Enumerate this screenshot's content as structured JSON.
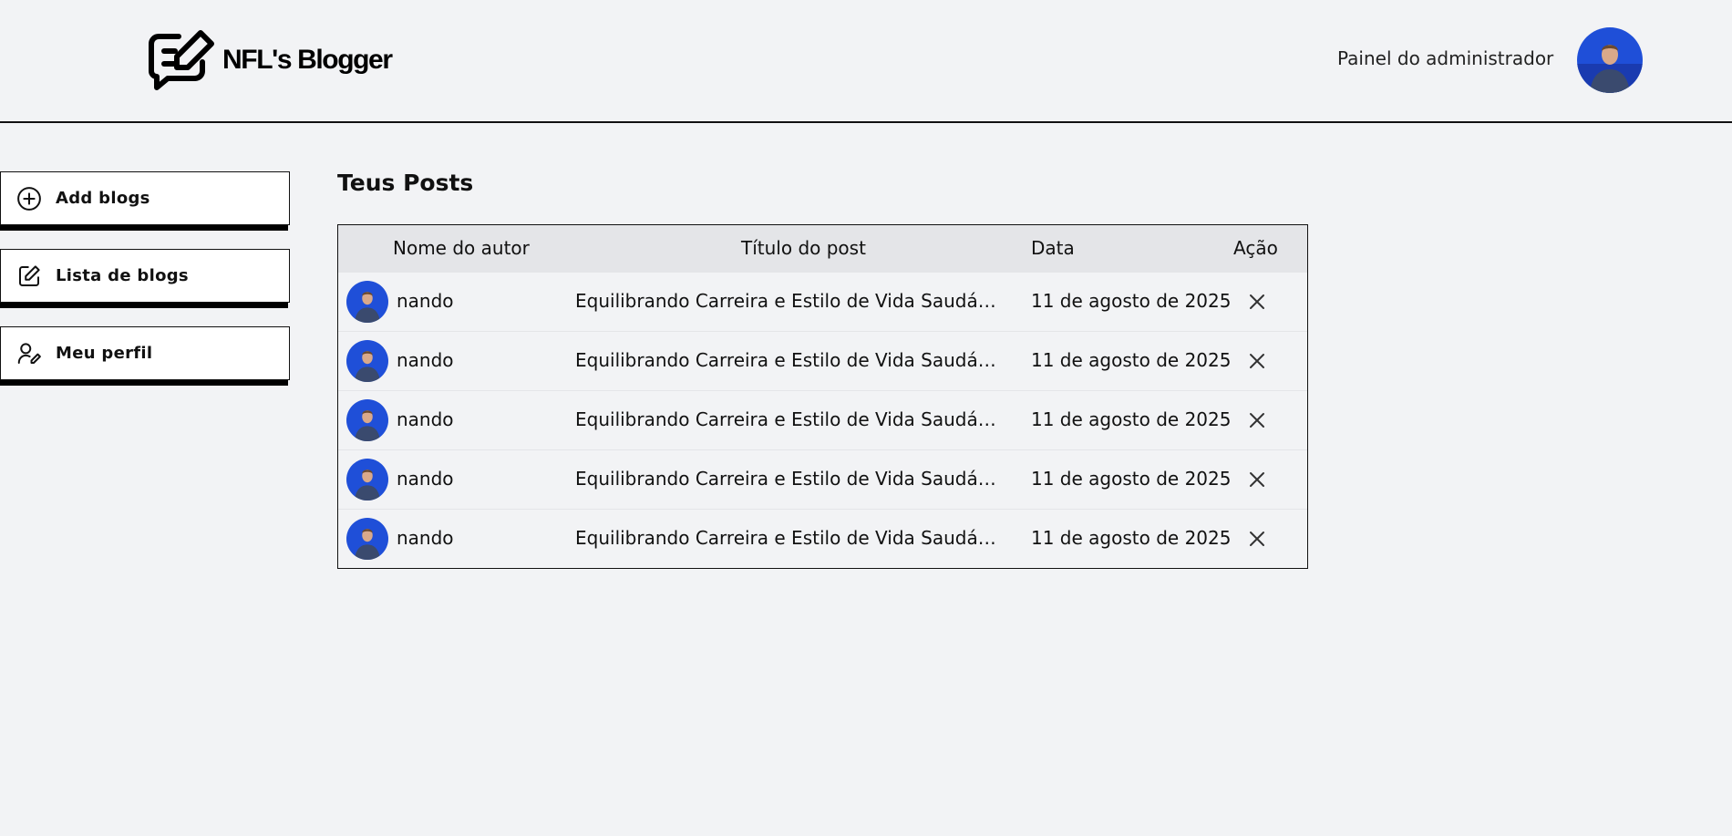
{
  "brand": {
    "name": "NFL's Blogger",
    "logo_icon": "chat-pencil-icon"
  },
  "header": {
    "admin_label": "Painel do administrador",
    "avatar_icon": "user-avatar"
  },
  "sidebar": {
    "items": [
      {
        "label": "Add blogs",
        "icon": "plus-circle-icon"
      },
      {
        "label": "Lista de blogs",
        "icon": "edit-square-icon"
      },
      {
        "label": "Meu perfil",
        "icon": "user-edit-icon"
      }
    ]
  },
  "main": {
    "title": "Teus Posts",
    "columns": [
      "Nome do autor",
      "Título do post",
      "Data",
      "Ação"
    ],
    "rows": [
      {
        "author": "nando",
        "title": "Equilibrando Carreira e Estilo de Vida Saudáv...",
        "date": "11 de agosto de 2025"
      },
      {
        "author": "nando",
        "title": "Equilibrando Carreira e Estilo de Vida Saudáv...",
        "date": "11 de agosto de 2025"
      },
      {
        "author": "nando",
        "title": "Equilibrando Carreira e Estilo de Vida Saudáv...",
        "date": "11 de agosto de 2025"
      },
      {
        "author": "nando",
        "title": "Equilibrando Carreira e Estilo de Vida Saudáv...",
        "date": "11 de agosto de 2025"
      },
      {
        "author": "nando",
        "title": "Equilibrando Carreira e Estilo de Vida Saudáv...",
        "date": "11 de agosto de 2025"
      }
    ]
  },
  "colors": {
    "background": "#f2f3f5",
    "header_row": "#e4e5e8",
    "text": "#111111",
    "avatar_blue": "#1f4fd8"
  }
}
